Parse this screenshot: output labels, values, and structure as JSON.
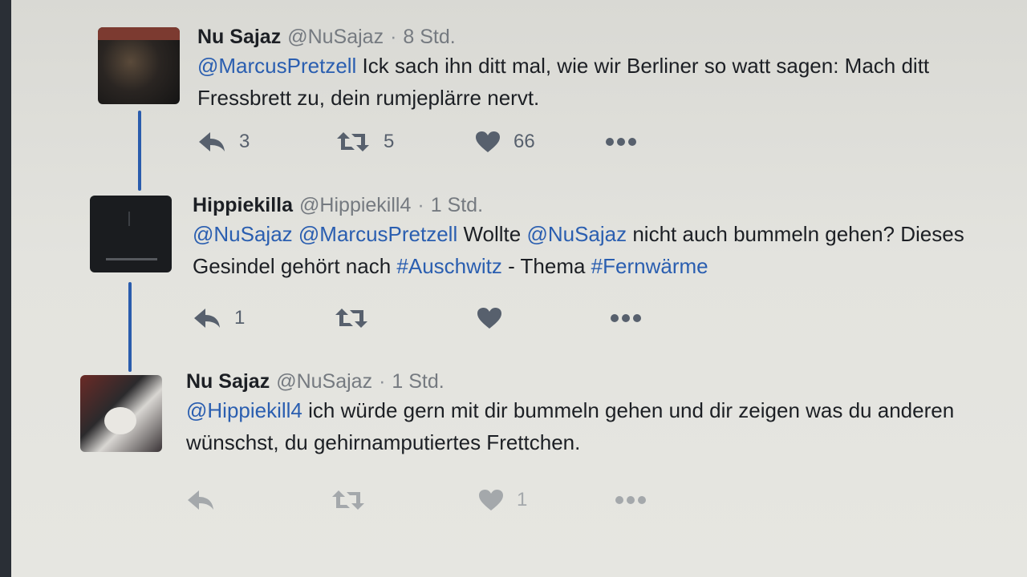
{
  "tweets": [
    {
      "name": "Nu Sajaz",
      "handle": "@NuSajaz",
      "sep": "·",
      "time": "8 Std.",
      "text_parts": [
        {
          "t": "@MarcusPretzell",
          "k": "mention"
        },
        {
          "t": " Ick sach ihn ditt mal, wie wir Berliner so watt sagen: Mach ditt Fressbrett zu, dein rumjeplärre nervt.",
          "k": "plain"
        }
      ],
      "reply_count": "3",
      "retweet_count": "5",
      "like_count": "66"
    },
    {
      "name": "Hippiekilla",
      "handle": "@Hippiekill4",
      "sep": "·",
      "time": "1 Std.",
      "text_parts": [
        {
          "t": "@NuSajaz",
          "k": "mention"
        },
        {
          "t": " ",
          "k": "plain"
        },
        {
          "t": "@MarcusPretzell",
          "k": "mention"
        },
        {
          "t": " Wollte ",
          "k": "plain"
        },
        {
          "t": "@NuSajaz",
          "k": "mention"
        },
        {
          "t": " nicht auch bummeln gehen? Dieses Gesindel gehört nach ",
          "k": "plain"
        },
        {
          "t": "#Auschwitz",
          "k": "hashtag"
        },
        {
          "t": " - Thema ",
          "k": "plain"
        },
        {
          "t": "#Fernwärme",
          "k": "hashtag"
        }
      ],
      "reply_count": "1",
      "retweet_count": "",
      "like_count": ""
    },
    {
      "name": "Nu Sajaz",
      "handle": "@NuSajaz",
      "sep": "·",
      "time": "1 Std.",
      "text_parts": [
        {
          "t": "@Hippiekill4",
          "k": "mention"
        },
        {
          "t": " ich würde gern mit dir bummeln gehen und dir zeigen was du anderen wünschst, du gehirnamputiertes Frettchen.",
          "k": "plain"
        }
      ],
      "reply_count": "",
      "retweet_count": "",
      "like_count": "1"
    }
  ],
  "icons": {
    "reply": "reply-icon",
    "retweet": "retweet-icon",
    "like": "heart-icon",
    "more": "more-dots-icon"
  },
  "colors": {
    "link": "#2a5eb0",
    "thread_line": "#2a5cad",
    "action": "#57606d",
    "text": "#1c1f24"
  }
}
